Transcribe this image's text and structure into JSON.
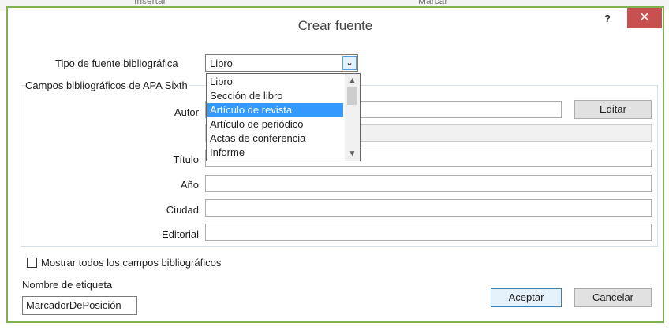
{
  "background": {
    "left_text": "Insertar",
    "right_text": "Marcar"
  },
  "dialog": {
    "title": "Crear fuente",
    "help_label": "?",
    "close_label": "✕",
    "source_type_label": "Tipo de fuente bibliográfica",
    "source_type_value": "Libro",
    "group_title": "Campos bibliográficos de APA Sixth",
    "fields": [
      {
        "label": "Autor",
        "value": ""
      },
      {
        "label": "Título",
        "value": ""
      },
      {
        "label": "Año",
        "value": ""
      },
      {
        "label": "Ciudad",
        "value": ""
      },
      {
        "label": "Editorial",
        "value": ""
      }
    ],
    "edit_button": "Editar",
    "show_all_label": "Mostrar todos los campos bibliográficos",
    "tag_label": "Nombre de etiqueta",
    "tag_value": "MarcadorDePosición",
    "ok_button": "Aceptar",
    "cancel_button": "Cancelar"
  },
  "dropdown": {
    "items": [
      "Libro",
      "Sección de libro",
      "Artículo de revista",
      "Artículo de periódico",
      "Actas de conferencia",
      "Informe"
    ],
    "selected": "Artículo de revista"
  },
  "colors": {
    "accent": "#7fb14f",
    "close": "#c75050",
    "selection": "#3399ff"
  }
}
